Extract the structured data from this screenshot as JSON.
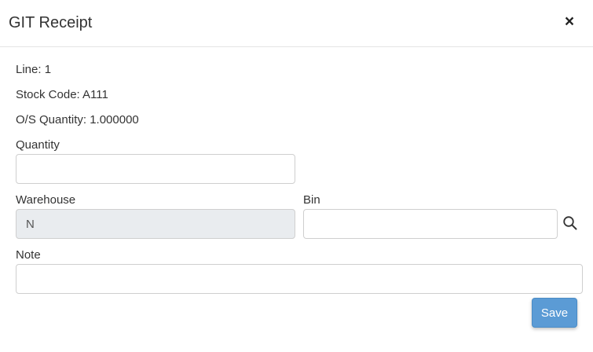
{
  "dialog": {
    "title": "GIT Receipt",
    "close_label": "×"
  },
  "info": {
    "line": "Line: 1",
    "stock_code": "Stock Code: A111",
    "os_quantity": "O/S Quantity: 1.000000"
  },
  "form": {
    "quantity": {
      "label": "Quantity",
      "value": "",
      "placeholder": ""
    },
    "warehouse": {
      "label": "Warehouse",
      "value": "N"
    },
    "bin": {
      "label": "Bin",
      "value": "",
      "placeholder": ""
    },
    "note": {
      "label": "Note",
      "value": "",
      "placeholder": ""
    }
  },
  "actions": {
    "save_label": "Save"
  },
  "icons": {
    "close": "close-icon",
    "bin_search": "search-icon"
  },
  "colors": {
    "primary_button": "#5b9bd5",
    "readonly_field": "#e9ecef"
  }
}
